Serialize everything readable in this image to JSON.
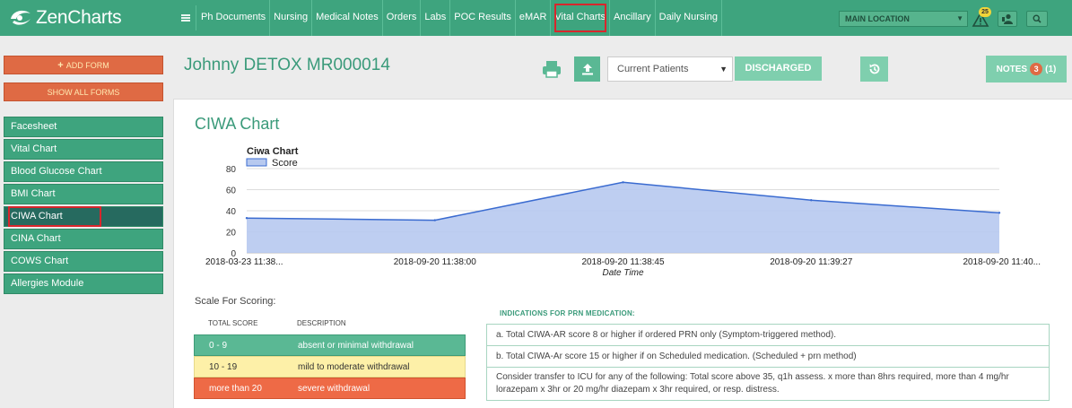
{
  "app": {
    "name": "ZenCharts"
  },
  "nav": {
    "items": [
      "Ph Documents",
      "Nursing",
      "Medical Notes",
      "Orders",
      "Labs",
      "POC Results",
      "eMAR",
      "Vital Charts",
      "Ancillary",
      "Daily Nursing"
    ],
    "active": "Vital Charts"
  },
  "toolbar": {
    "location": "MAIN LOCATION",
    "alert_count": "25"
  },
  "sidebar": {
    "add_form": "ADD FORM",
    "show_all_forms": "SHOW ALL FORMS",
    "items": [
      "Facesheet",
      "Vital Chart",
      "Blood Glucose Chart",
      "BMI Chart",
      "CIWA Chart",
      "CINA Chart",
      "COWS Chart",
      "Allergies Module"
    ],
    "active": "CIWA Chart"
  },
  "header": {
    "patient": "Johnny DETOX MR000014",
    "patients_filter": "Current Patients",
    "discharged_label": "DISCHARGED",
    "notes_label": "NOTES",
    "notes_badge": "3",
    "notes_count": "(1)"
  },
  "chart_title": "CIWA Chart",
  "chart_data": {
    "type": "area",
    "title": "Ciwa Chart",
    "legend": "Score",
    "xlabel": "Date Time",
    "ylabel": "",
    "categories": [
      "2018-03-23 11:38...",
      "2018-09-20 11:38:00",
      "2018-09-20 11:38:45",
      "2018-09-20 11:39:27",
      "2018-09-20 11:40..."
    ],
    "series": [
      {
        "name": "Score",
        "values": [
          33,
          31,
          67,
          50,
          38
        ]
      }
    ],
    "ylim": [
      0,
      80
    ],
    "yticks": [
      0,
      20,
      40,
      60,
      80
    ],
    "grid": true,
    "colors": {
      "line": "#3a6bd0",
      "fill": "#b7c9ef"
    }
  },
  "scale": {
    "title": "Scale For Scoring:",
    "headers": [
      "TOTAL SCORE",
      "DESCRIPTION"
    ],
    "rows": [
      {
        "score": "0 - 9",
        "desc": "absent or minimal withdrawal",
        "color": "#5ab894"
      },
      {
        "score": "10 - 19",
        "desc": "mild to moderate withdrawal",
        "color": "#fdf0a8"
      },
      {
        "score": "more than 20",
        "desc": "severe withdrawal",
        "color": "#ee6a46"
      }
    ]
  },
  "indications": {
    "title": "INDICATIONS FOR PRN MEDICATION:",
    "items": [
      "a. Total CIWA-AR score 8 or higher if ordered PRN only (Symptom-triggered method).",
      "b. Total CIWA-Ar score 15 or higher if on Scheduled medication. (Scheduled + prn method)",
      "Consider transfer to ICU for any of the following: Total score above 35, q1h assess. x more than 8hrs required, more than 4 mg/hr lorazepam x 3hr or 20 mg/hr diazepam x 3hr required, or resp. distress."
    ]
  }
}
